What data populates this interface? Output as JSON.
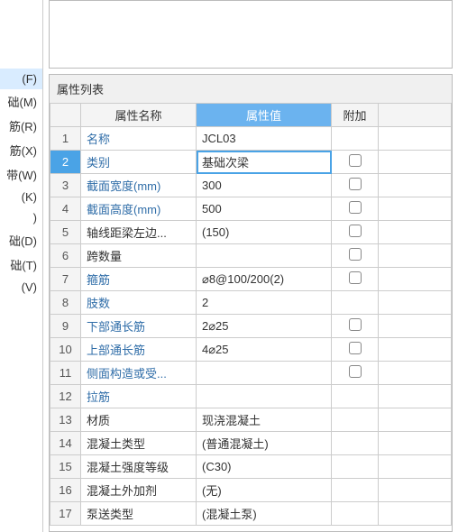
{
  "sidebar": {
    "items": [
      {
        "label": "(F)",
        "selected": true
      },
      {
        "label": "础(M)",
        "selected": false
      },
      {
        "label": "筋(R)",
        "selected": false
      },
      {
        "label": "筋(X)",
        "selected": false
      },
      {
        "label": "带(W)",
        "selected": false
      },
      {
        "label": "(K)",
        "selected": false
      },
      {
        "label": ")",
        "selected": false
      },
      {
        "label": "础(D)",
        "selected": false
      },
      {
        "label": "础(T)",
        "selected": false
      },
      {
        "label": "(V)",
        "selected": false
      }
    ]
  },
  "panel": {
    "title": "属性列表",
    "columns": {
      "index": "",
      "name": "属性名称",
      "value": "属性值",
      "addon": "附加"
    },
    "rows": [
      {
        "i": "1",
        "name": "名称",
        "name_black": false,
        "value": "JCL03",
        "addon": null,
        "active": false
      },
      {
        "i": "2",
        "name": "类别",
        "name_black": false,
        "value": "基础次梁",
        "addon": false,
        "active": true
      },
      {
        "i": "3",
        "name": "截面宽度(mm)",
        "name_black": false,
        "value": "300",
        "addon": false,
        "active": false
      },
      {
        "i": "4",
        "name": "截面高度(mm)",
        "name_black": false,
        "value": "500",
        "addon": false,
        "active": false
      },
      {
        "i": "5",
        "name": "轴线距梁左边...",
        "name_black": true,
        "value": "(150)",
        "addon": false,
        "active": false
      },
      {
        "i": "6",
        "name": "跨数量",
        "name_black": true,
        "value": "",
        "addon": false,
        "active": false
      },
      {
        "i": "7",
        "name": "箍筋",
        "name_black": false,
        "value": "⌀8@100/200(2)",
        "addon": false,
        "active": false
      },
      {
        "i": "8",
        "name": "肢数",
        "name_black": false,
        "value": "2",
        "addon": null,
        "active": false
      },
      {
        "i": "9",
        "name": "下部通长筋",
        "name_black": false,
        "value": "2⌀25",
        "addon": false,
        "active": false
      },
      {
        "i": "10",
        "name": "上部通长筋",
        "name_black": false,
        "value": "4⌀25",
        "addon": false,
        "active": false
      },
      {
        "i": "11",
        "name": "侧面构造或受...",
        "name_black": false,
        "value": "",
        "addon": false,
        "active": false
      },
      {
        "i": "12",
        "name": "拉筋",
        "name_black": false,
        "value": "",
        "addon": null,
        "active": false
      },
      {
        "i": "13",
        "name": "材质",
        "name_black": true,
        "value": "现浇混凝土",
        "addon": null,
        "active": false
      },
      {
        "i": "14",
        "name": "混凝土类型",
        "name_black": true,
        "value": "(普通混凝土)",
        "addon": null,
        "active": false
      },
      {
        "i": "15",
        "name": "混凝土强度等级",
        "name_black": true,
        "value": "(C30)",
        "addon": null,
        "active": false
      },
      {
        "i": "16",
        "name": "混凝土外加剂",
        "name_black": true,
        "value": "(无)",
        "addon": null,
        "active": false
      },
      {
        "i": "17",
        "name": "泵送类型",
        "name_black": true,
        "value": "(混凝土泵)",
        "addon": null,
        "active": false
      }
    ]
  }
}
